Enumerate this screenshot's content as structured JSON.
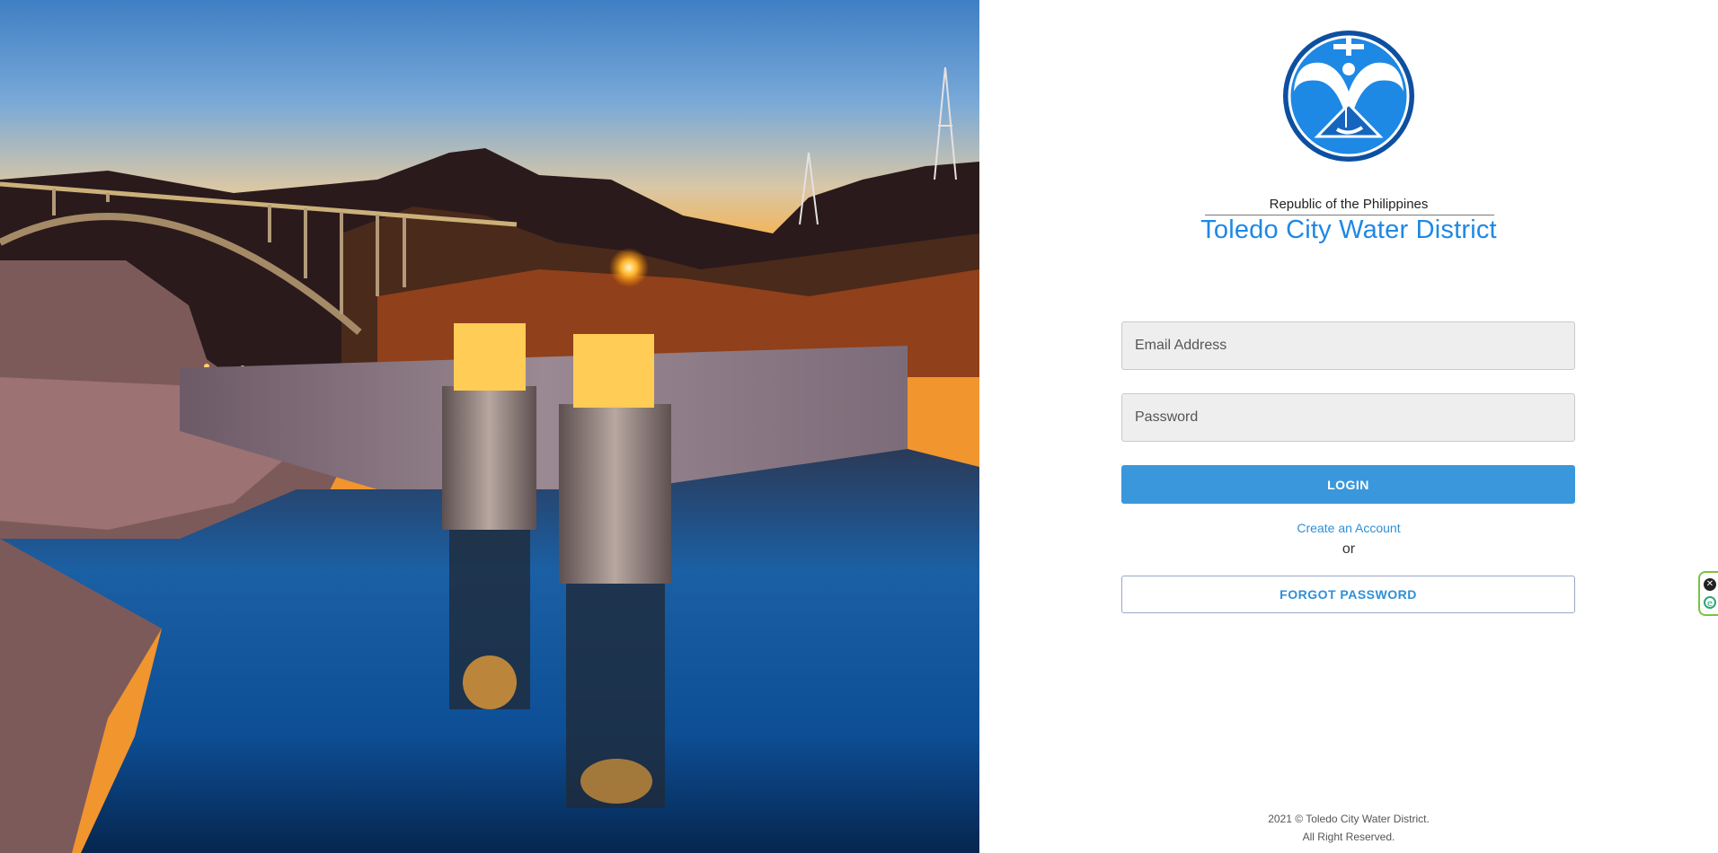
{
  "hero": {
    "image_icon": "hoover-dam-night-photo"
  },
  "branding": {
    "logo_icon": "water-district-logo",
    "republic_text": "Republic of the Philippines",
    "org_name": "Toledo City Water District",
    "accent_color": "#1e88e5"
  },
  "form": {
    "email_placeholder": "Email Address",
    "email_value": "",
    "password_placeholder": "Password",
    "password_value": "",
    "login_label": "LOGIN",
    "login_color": "#3a97dc",
    "create_account_label": "Create an Account",
    "or_label": "or",
    "forgot_password_label": "FORGOT PASSWORD"
  },
  "footer": {
    "line1": "2021 © Toledo City Water District.",
    "line2": "All Right Reserved."
  },
  "side_widget": {
    "close_icon": "close-icon",
    "close_glyph": "✕",
    "extra_icon": "extension-icon",
    "extra_glyph": "e"
  }
}
